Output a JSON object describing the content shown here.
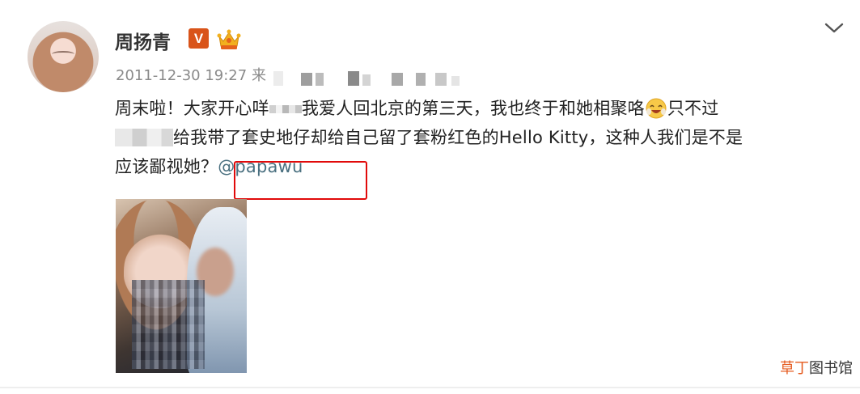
{
  "user": {
    "name": "周扬青",
    "badge_text": "V"
  },
  "post": {
    "timestamp": "2011-12-30 19:27",
    "source_prefix": "来",
    "line1_a": "周末啦！大家开心咩",
    "line1_b": "我爱人回北京的第三天，我也终于和她相聚咯",
    "line1_c": "只不过",
    "line2_a": "给我带了套史地仔却给自己留了套粉红色的Hello Kitty，这种人我们是不是",
    "line3_a": "应该鄙视她？",
    "mention": "@papawu"
  },
  "watermark": {
    "accent": "草丁",
    "rest": "图书馆"
  },
  "colors": {
    "vip_badge": "#d9541a",
    "mention": "#4a7080",
    "highlight": "#e10a0a",
    "watermark_accent": "#e55b1f"
  },
  "icons": {
    "verified": "verified-v-badge-icon",
    "crown": "crown-member-icon",
    "dropdown": "chevron-down-icon",
    "emoji": "laughing-emoji-icon"
  }
}
